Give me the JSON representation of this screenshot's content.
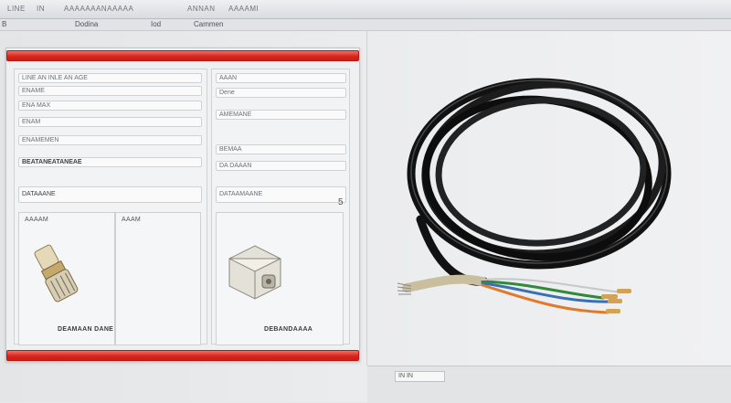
{
  "window": {
    "title_segments": [
      "LINE",
      "IN",
      "AAAAAAANAAAAA",
      "ANNAN",
      "AAAAMI"
    ],
    "menu_left": "B",
    "menu_items": [
      "Dodina",
      "Iod",
      "Cammen"
    ]
  },
  "dialog": {
    "left_rows": [
      "LINE AN INLE AN AGE",
      "ENAME",
      "ENA MAX",
      "ENAM",
      "ENAMEMEN",
      "BEATANEATANEAE"
    ],
    "left_selected": "DATAAANE",
    "left_sub_labels": [
      "AAAAM",
      "AAAM"
    ],
    "left_caption": "DEAMAAN DANE",
    "right_rows": [
      "AAAN",
      "Dene",
      "AMEMANE",
      "BEMAA",
      "DA DAAAN",
      "DATAAMAANE"
    ],
    "right_caption": "DEBANDAAAA"
  },
  "side_marker": "5",
  "bottom_bar": {
    "field": "IN IN"
  },
  "colors": {
    "titlebar_accent": "#d8261c",
    "cable_jacket": "#161616",
    "wire_green": "#2f8a3a",
    "wire_blue": "#3a6fb5",
    "wire_orange": "#e07a2a"
  },
  "icons": [
    "connector-pin-icon",
    "connector-housing-icon",
    "cable-coil-image"
  ]
}
